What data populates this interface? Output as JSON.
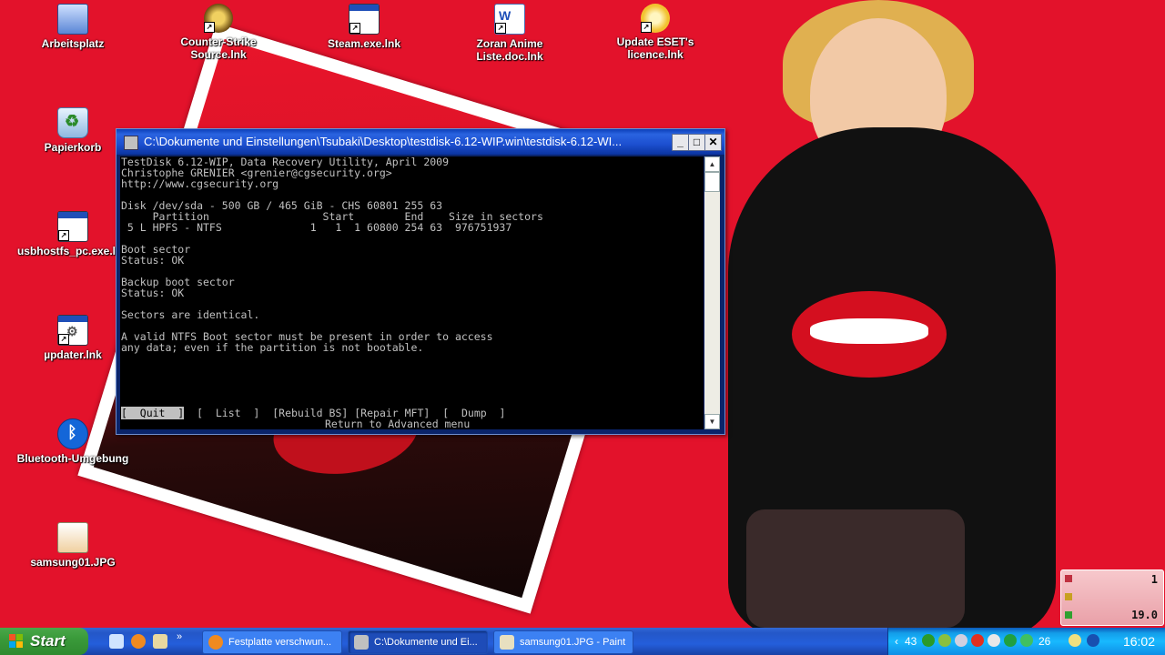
{
  "desktop": {
    "icons": [
      {
        "label": "Arbeitsplatz",
        "icon": "my-computer-icon"
      },
      {
        "label": "Counter-Strike Source.lnk",
        "icon": "counter-strike-icon"
      },
      {
        "label": "Steam.exe.lnk",
        "icon": "application-window-icon"
      },
      {
        "label": "Zoran Anime Liste.doc.lnk",
        "icon": "word-document-icon"
      },
      {
        "label": "Update ESET's licence.lnk",
        "icon": "eset-update-icon"
      },
      {
        "label": "Papierkorb",
        "icon": "recycle-bin-icon"
      },
      {
        "label": "usbhostfs_pc.exe.lnk",
        "icon": "application-window-icon"
      },
      {
        "label": "µpdater.lnk",
        "icon": "updater-gear-icon"
      },
      {
        "label": "Bluetooth-Umgebung",
        "icon": "bluetooth-icon"
      },
      {
        "label": "samsung01.JPG",
        "icon": "jpg-image-icon"
      }
    ]
  },
  "console": {
    "title": "C:\\Dokumente und Einstellungen\\Tsubaki\\Desktop\\testdisk-6.12-WIP.win\\testdisk-6.12-WI...",
    "lines": [
      "TestDisk 6.12-WIP, Data Recovery Utility, April 2009",
      "Christophe GRENIER <grenier@cgsecurity.org>",
      "http://www.cgsecurity.org",
      "",
      "Disk /dev/sda - 500 GB / 465 GiB - CHS 60801 255 63",
      "     Partition                  Start        End    Size in sectors",
      " 5 L HPFS - NTFS              1   1  1 60800 254 63  976751937",
      "",
      "Boot sector",
      "Status: OK",
      "",
      "Backup boot sector",
      "Status: OK",
      "",
      "Sectors are identical.",
      "",
      "A valid NTFS Boot sector must be present in order to access",
      "any data; even if the partition is not bootable."
    ],
    "menu": {
      "quit": "[  Quit  ]",
      "list": "[  List  ]",
      "rebuild": "[Rebuild BS]",
      "repair": "[Repair MFT]",
      "dump": "[  Dump  ]",
      "hint": "Return to Advanced menu"
    },
    "buttons": {
      "minimize": "_",
      "maximize": "□",
      "close": "✕"
    }
  },
  "gadget": {
    "top_value": "1",
    "bottom_value": "19.0"
  },
  "taskbar": {
    "start_label": "Start",
    "more_label": "»",
    "tasks": [
      {
        "label": "Festplatte verschwun...",
        "icon": "firefox-icon"
      },
      {
        "label": "C:\\Dokumente und Ei...",
        "icon": "console-icon"
      },
      {
        "label": "samsung01.JPG - Paint",
        "icon": "paint-icon"
      }
    ],
    "tray": {
      "value1": "43",
      "value2": "26",
      "clock": "16:02",
      "expand": "‹"
    }
  },
  "colors": {
    "desktop_bg": "#e3122b",
    "console_bg": "#000000",
    "console_fg": "#c0c0c0",
    "taskbar": "#245edb"
  }
}
